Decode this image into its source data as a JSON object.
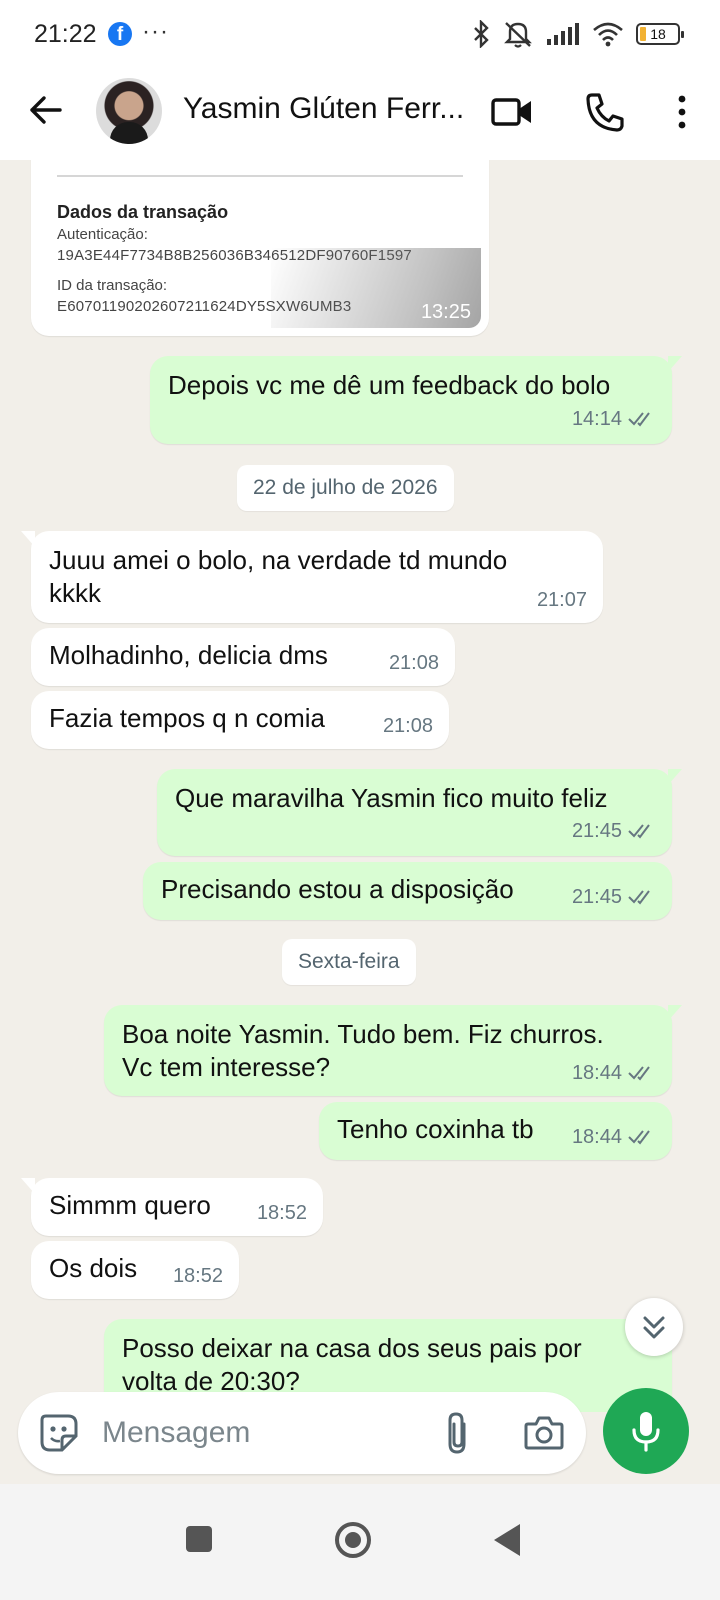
{
  "status_bar": {
    "time": "21:22",
    "notification_dots": "···",
    "battery": "18"
  },
  "header": {
    "contact_name": "Yasmin Glúten Ferr..."
  },
  "receipt": {
    "section_title": "Dados da transação",
    "auth_label": "Autenticação:",
    "auth_value": "19A3E44F7734B8B256036B346512DF90760F1597",
    "id_label": "ID da transação:",
    "id_value": "E60701190202607211624DY5SXW6UMB3",
    "time": "13:25"
  },
  "messages": [
    {
      "dir": "out",
      "lines": [
        "Depois vc me dê um feedback do bolo"
      ],
      "time": "14:14"
    },
    {
      "dir": "in",
      "lines": [
        "Juuu amei o bolo, na verdade td mundo",
        "kkkk"
      ],
      "time": "21:07"
    },
    {
      "dir": "in",
      "lines": [
        "Molhadinho, delicia dms"
      ],
      "time": "21:08"
    },
    {
      "dir": "in",
      "lines": [
        "Fazia tempos q n comia"
      ],
      "time": "21:08"
    },
    {
      "dir": "out",
      "lines": [
        "Que maravilha Yasmin fico muito feliz"
      ],
      "time": "21:45"
    },
    {
      "dir": "out",
      "lines": [
        "Precisando estou a disposição"
      ],
      "time": "21:45"
    },
    {
      "dir": "out",
      "lines": [
        "Boa noite Yasmin. Tudo bem. Fiz churros.",
        "Vc tem interesse?"
      ],
      "time": "18:44"
    },
    {
      "dir": "out",
      "lines": [
        "Tenho coxinha tb"
      ],
      "time": "18:44"
    },
    {
      "dir": "in",
      "lines": [
        "Simmm quero"
      ],
      "time": "18:52"
    },
    {
      "dir": "in",
      "lines": [
        "Os dois"
      ],
      "time": "18:52"
    },
    {
      "dir": "out",
      "lines": [
        "Posso deixar na casa dos seus pais por",
        "volta de 20:30?"
      ],
      "time": ""
    }
  ],
  "date_chips": [
    "22 de julho de 2026",
    "Sexta-feira"
  ],
  "composer": {
    "placeholder": "Mensagem"
  },
  "colors": {
    "chat_background": "#f2efe9",
    "incoming_bubble": "#ffffff",
    "outgoing_bubble": "#d9fdd3",
    "mic_button": "#1fa855",
    "facebook_badge": "#1877f2"
  },
  "icons": [
    "facebook-icon",
    "bluetooth-icon",
    "mute-icon",
    "signal-icon",
    "wifi-icon",
    "battery-icon",
    "back-arrow-icon",
    "video-call-icon",
    "phone-call-icon",
    "more-vert-icon",
    "double-check-icon",
    "chevron-double-down-icon",
    "sticker-icon",
    "paperclip-icon",
    "camera-icon",
    "microphone-icon"
  ]
}
